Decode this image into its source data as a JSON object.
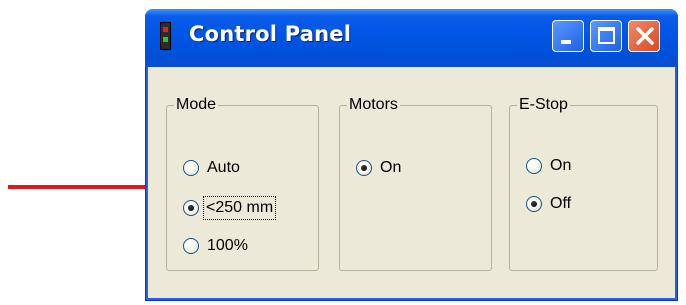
{
  "window": {
    "title": "Control Panel",
    "buttons": [
      "minimize",
      "maximize",
      "close"
    ]
  },
  "groups": {
    "mode": {
      "legend": "Mode",
      "options": [
        {
          "label": "Auto",
          "checked": false
        },
        {
          "label": "<250 mm",
          "checked": true
        },
        {
          "label": "100%",
          "checked": false
        }
      ]
    },
    "motors": {
      "legend": "Motors",
      "options": [
        {
          "label": "On",
          "checked": true
        }
      ]
    },
    "estop": {
      "legend": "E-Stop",
      "options": [
        {
          "label": "On",
          "checked": false
        },
        {
          "label": "Off",
          "checked": true
        }
      ]
    }
  },
  "annotation": {
    "arrow_color": "#e8141b",
    "points_to": "mode-option-lt250mm"
  },
  "colors": {
    "titlebar": "#0055e5",
    "window_bg": "#ece9d8",
    "close_button": "#d84a1f"
  }
}
